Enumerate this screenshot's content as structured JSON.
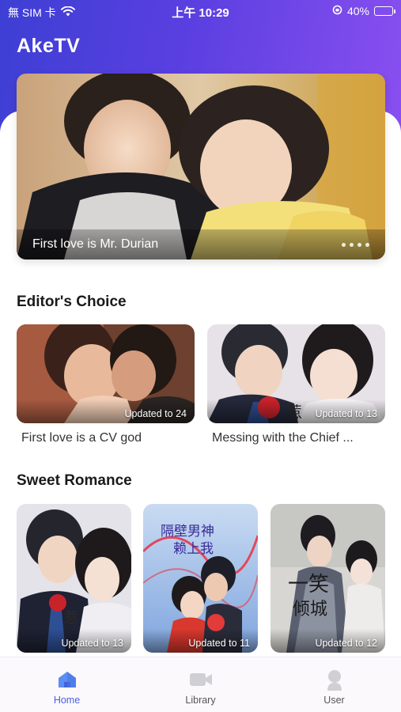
{
  "status_bar": {
    "carrier": "無 SIM 卡",
    "time": "上午 10:29",
    "battery": "40%",
    "battery_level": 0.4
  },
  "app": {
    "title": "AkeTV"
  },
  "hero": {
    "caption": "First love is Mr. Durian",
    "dots": 4
  },
  "editors_choice": {
    "title": "Editor's Choice",
    "items": [
      {
        "title": "First love is a CV god",
        "badge": "Updated to 24"
      },
      {
        "title": "Messing with the Chief ...",
        "badge": "Updated to 13"
      }
    ]
  },
  "sweet_romance": {
    "title": "Sweet Romance",
    "items": [
      {
        "badge": "Updated to 13"
      },
      {
        "badge": "Updated to 11"
      },
      {
        "badge": "Updated to 12"
      }
    ]
  },
  "bottom_nav": {
    "items": [
      {
        "label": "Home",
        "icon": "home-icon",
        "active": true
      },
      {
        "label": "Library",
        "icon": "video-library-icon",
        "active": false
      },
      {
        "label": "User",
        "icon": "user-icon",
        "active": false
      }
    ]
  },
  "colors": {
    "header_start": "#3d3fd4",
    "header_end": "#8a4ff0",
    "nav_active": "#4a5fe0"
  }
}
